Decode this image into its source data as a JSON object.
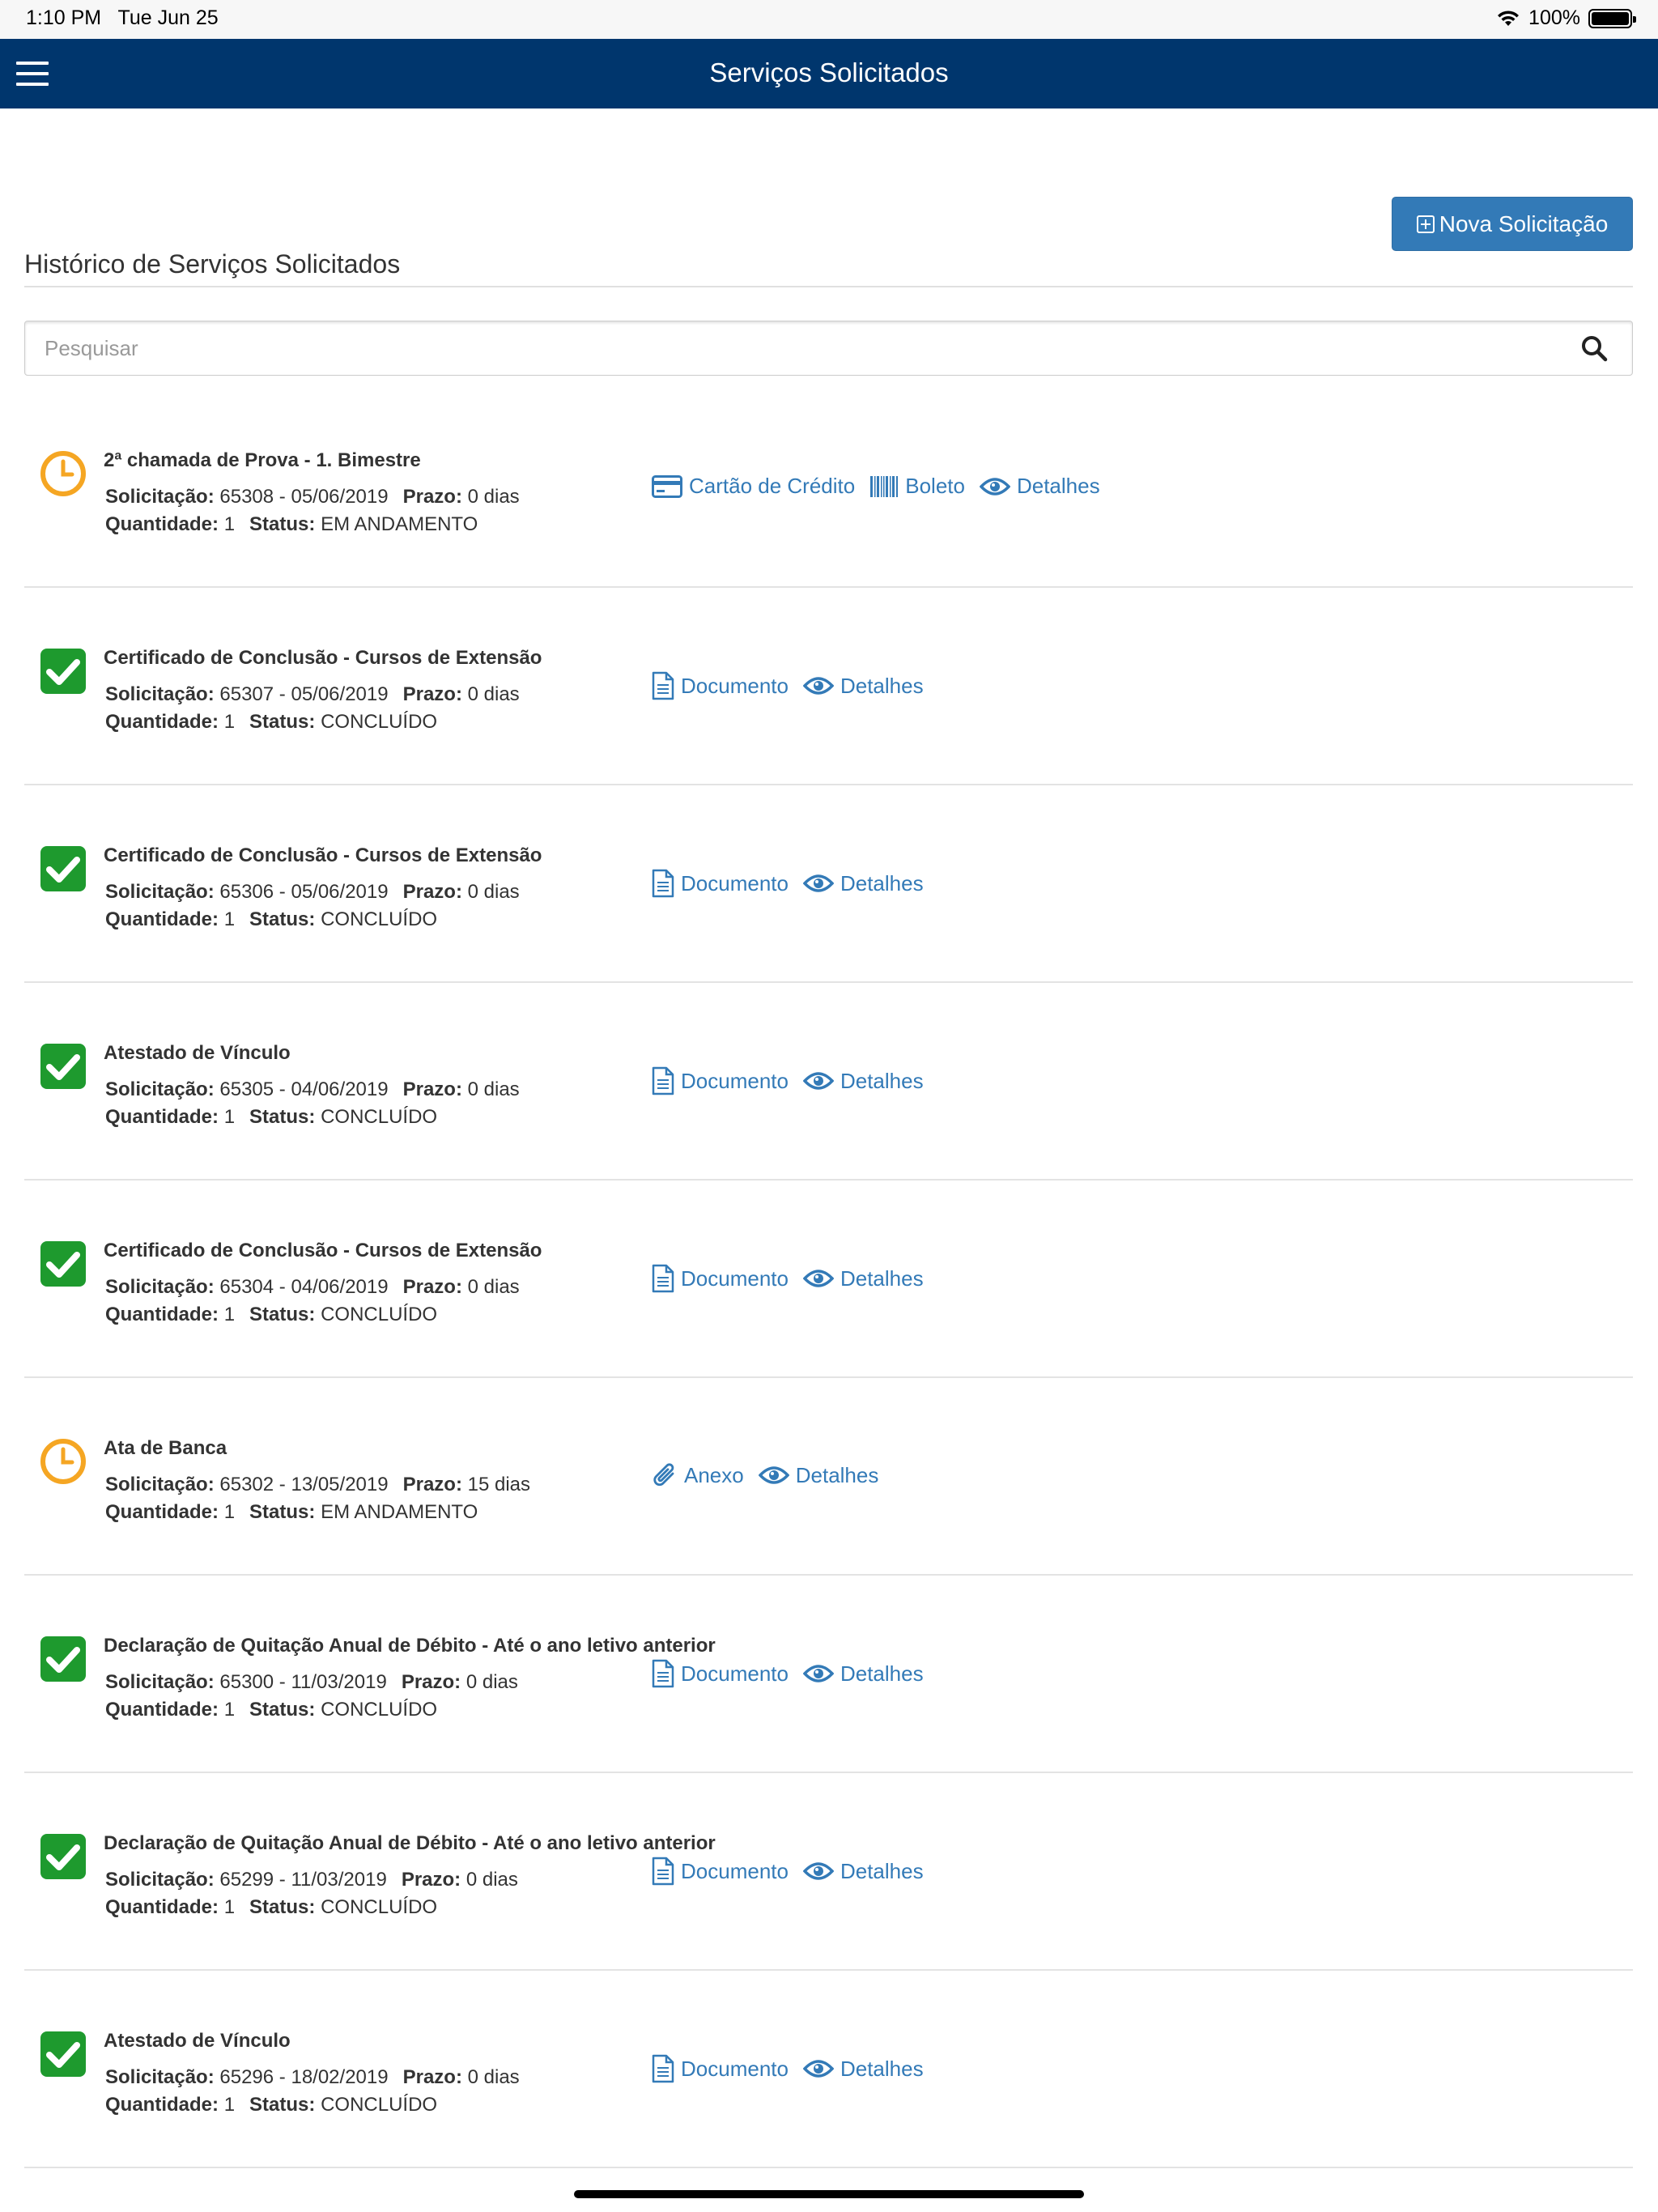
{
  "status_bar": {
    "time": "1:10 PM",
    "date": "Tue Jun 25",
    "battery": "100%"
  },
  "nav": {
    "title": "Serviços Solicitados"
  },
  "header": {
    "new_button": "Nova Solicitação",
    "section_title": "Histórico de Serviços Solicitados"
  },
  "search": {
    "placeholder": "Pesquisar"
  },
  "labels": {
    "solicitacao": "Solicitação:",
    "prazo": "Prazo:",
    "quantidade": "Quantidade:",
    "status": "Status:"
  },
  "actions": {
    "credit_card": "Cartão de Crédito",
    "boleto": "Boleto",
    "details": "Detalhes",
    "document": "Documento",
    "attachment": "Anexo"
  },
  "items": [
    {
      "title": "2ª chamada de Prova - 1. Bimestre",
      "number": "65308",
      "date": "05/06/2019",
      "prazo": "0 dias",
      "quantity": "1",
      "status": "EM ANDAMENTO",
      "state": "pending",
      "status_icon": "clock-icon",
      "actions": [
        "credit_card",
        "boleto",
        "details"
      ]
    },
    {
      "title": "Certificado de Conclusão - Cursos de Extensão",
      "number": "65307",
      "date": "05/06/2019",
      "prazo": "0 dias",
      "quantity": "1",
      "status": "CONCLUÍDO",
      "state": "done",
      "status_icon": "check-icon",
      "actions": [
        "document",
        "details"
      ]
    },
    {
      "title": "Certificado de Conclusão - Cursos de Extensão",
      "number": "65306",
      "date": "05/06/2019",
      "prazo": "0 dias",
      "quantity": "1",
      "status": "CONCLUÍDO",
      "state": "done",
      "status_icon": "check-icon",
      "actions": [
        "document",
        "details"
      ]
    },
    {
      "title": "Atestado de Vínculo",
      "number": "65305",
      "date": "04/06/2019",
      "prazo": "0 dias",
      "quantity": "1",
      "status": "CONCLUÍDO",
      "state": "done",
      "status_icon": "check-icon",
      "actions": [
        "document",
        "details"
      ]
    },
    {
      "title": "Certificado de Conclusão - Cursos de Extensão",
      "number": "65304",
      "date": "04/06/2019",
      "prazo": "0 dias",
      "quantity": "1",
      "status": "CONCLUÍDO",
      "state": "done",
      "status_icon": "check-icon",
      "actions": [
        "document",
        "details"
      ]
    },
    {
      "title": "Ata de Banca",
      "number": "65302",
      "date": "13/05/2019",
      "prazo": "15 dias",
      "quantity": "1",
      "status": "EM ANDAMENTO",
      "state": "pending",
      "status_icon": "clock-icon",
      "actions": [
        "attachment",
        "details"
      ]
    },
    {
      "title": "Declaração de Quitação Anual de Débito - Até o ano letivo anterior",
      "number": "65300",
      "date": "11/03/2019",
      "prazo": "0 dias",
      "quantity": "1",
      "status": "CONCLUÍDO",
      "state": "done",
      "status_icon": "check-icon",
      "actions": [
        "document",
        "details"
      ]
    },
    {
      "title": "Declaração de Quitação Anual de Débito - Até o ano letivo anterior",
      "number": "65299",
      "date": "11/03/2019",
      "prazo": "0 dias",
      "quantity": "1",
      "status": "CONCLUÍDO",
      "state": "done",
      "status_icon": "check-icon",
      "actions": [
        "document",
        "details"
      ]
    },
    {
      "title": "Atestado de Vínculo",
      "number": "65296",
      "date": "18/02/2019",
      "prazo": "0 dias",
      "quantity": "1",
      "status": "CONCLUÍDO",
      "state": "done",
      "status_icon": "check-icon",
      "actions": [
        "document",
        "details"
      ]
    }
  ],
  "colors": {
    "nav_bg": "#00366d",
    "link": "#337ab7",
    "button": "#337ab7",
    "done": "#1e9a2e",
    "pending": "#f5a623"
  }
}
